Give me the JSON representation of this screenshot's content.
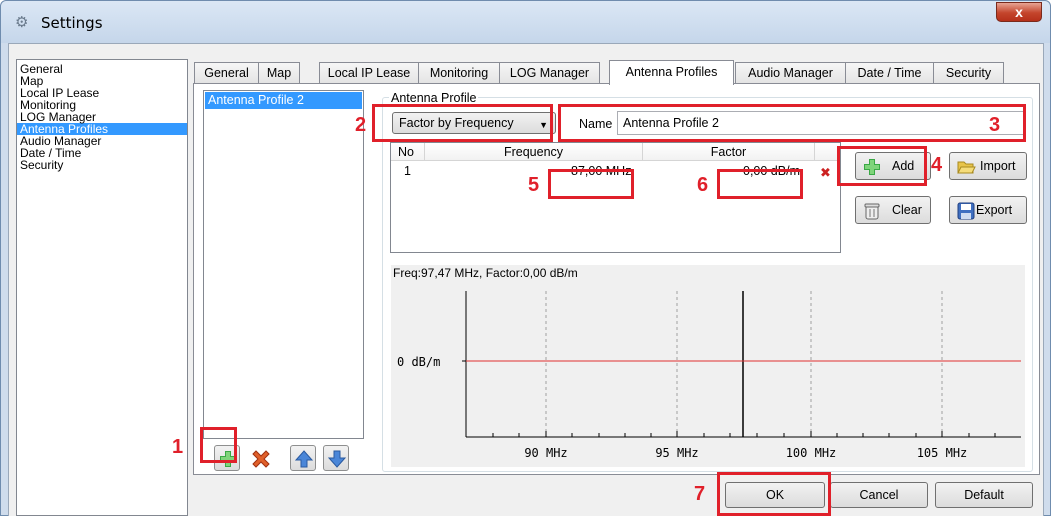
{
  "window": {
    "title": "Settings",
    "close_glyph": "x"
  },
  "nav": {
    "items": [
      {
        "label": "General"
      },
      {
        "label": "Map"
      },
      {
        "label": "Local IP Lease"
      },
      {
        "label": "Monitoring"
      },
      {
        "label": "LOG Manager"
      },
      {
        "label": "Antenna Profiles",
        "selected": true
      },
      {
        "label": "Audio Manager"
      },
      {
        "label": "Date / Time"
      },
      {
        "label": "Security"
      }
    ]
  },
  "tabs": [
    {
      "label": "General"
    },
    {
      "label": "Map"
    },
    {
      "label": "Local IP Lease"
    },
    {
      "label": "Monitoring"
    },
    {
      "label": "LOG Manager"
    },
    {
      "label": "Antenna Profiles",
      "active": true
    },
    {
      "label": "Audio Manager"
    },
    {
      "label": "Date / Time"
    },
    {
      "label": "Security"
    }
  ],
  "profiles": {
    "items": [
      "Antenna Profile 2"
    ]
  },
  "antenna_profile": {
    "group_label": "Antenna Profile",
    "mode_select": "Factor by Frequency",
    "name_label": "Name",
    "name_value": "Antenna Profile 2"
  },
  "table": {
    "headers": {
      "no": "No",
      "frequency": "Frequency",
      "factor": "Factor"
    },
    "rows": [
      {
        "no": "1",
        "frequency": "87,00 MHz",
        "factor": "0,00 dB/m"
      }
    ]
  },
  "buttons": {
    "add": "Add",
    "import": "Import",
    "clear": "Clear",
    "export": "Export",
    "ok": "OK",
    "cancel": "Cancel",
    "default": "Default"
  },
  "graph": {
    "caption": "Freq:97,47 MHz, Factor:0,00 dB/m",
    "y_label": "0 dB/m",
    "x_ticks": [
      "90 MHz",
      "95 MHz",
      "100 MHz",
      "105 MHz"
    ]
  },
  "annotations": [
    "1",
    "2",
    "3",
    "4",
    "5",
    "6",
    "7"
  ],
  "colors": {
    "selection": "#3399ff",
    "annotation_red": "#e0202a",
    "graph_line": "#e03030"
  }
}
